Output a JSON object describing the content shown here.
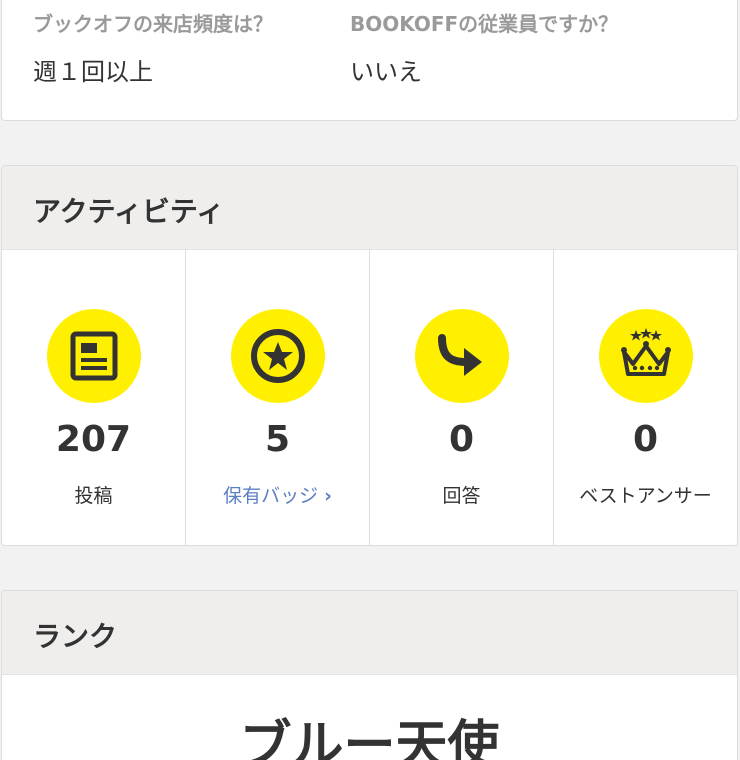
{
  "profile_qa": [
    {
      "question": "ブックオフの来店頻度は？",
      "answer": "週１回以上"
    },
    {
      "question": "BOOKOFFの従業員ですか？",
      "answer": "いいえ"
    }
  ],
  "activity": {
    "title": "アクティビティ",
    "stats": [
      {
        "icon": "post-icon",
        "value": "207",
        "label": "投稿"
      },
      {
        "icon": "badge-star-icon",
        "value": "5",
        "label": "保有バッジ",
        "link": true
      },
      {
        "icon": "answer-arrow-icon",
        "value": "0",
        "label": "回答"
      },
      {
        "icon": "crown-icon",
        "value": "0",
        "label": "ベストアンサー"
      }
    ]
  },
  "rank": {
    "title": "ランク",
    "name": "ブルー天使"
  },
  "colors": {
    "icon_bg": "#ffef00",
    "link": "#5b7fc4",
    "header_bg": "#efeeed"
  }
}
